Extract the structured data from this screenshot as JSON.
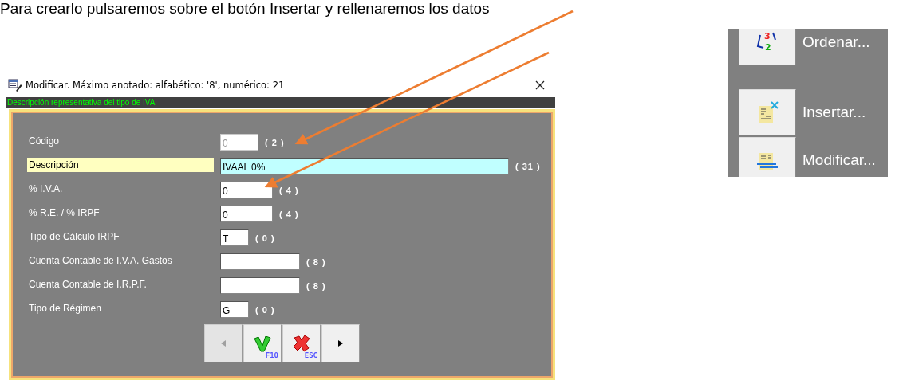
{
  "heading": "Para crearlo pulsaremos sobre el botón Insertar y rellenaremos los datos",
  "dialog": {
    "title": "Modificar.  Máximo anotado: alfabético: '8', numérico: 21",
    "hint": "Descripción representativa del tipo de IVA",
    "fields": [
      {
        "kind": "code",
        "label": "Código",
        "value": "0",
        "limit": "( 2 )",
        "focused": false,
        "disabled": true
      },
      {
        "kind": "text",
        "label": "Descripción",
        "value": "IVAAL 0%",
        "limit": "( 31 )",
        "focused": true,
        "disabled": false
      },
      {
        "kind": "number",
        "label": "% I.V.A.",
        "value": "0",
        "limit": "( 4 )",
        "focused": false,
        "disabled": false
      },
      {
        "kind": "number",
        "label": "% R.E. / % IRPF",
        "value": "0",
        "limit": "( 4 )",
        "focused": false,
        "disabled": false
      },
      {
        "kind": "flag",
        "label": "Tipo de Cálculo IRPF",
        "value": "T",
        "limit": "( 0 )",
        "focused": false,
        "disabled": false
      },
      {
        "kind": "account",
        "label": "Cuenta Contable de I.V.A. Gastos",
        "limit": "( 8 )",
        "focused": false
      },
      {
        "kind": "account",
        "label": "Cuenta Contable de I.R.P.F.",
        "limit": "( 8 )",
        "focused": false
      },
      {
        "kind": "flag",
        "label": "Tipo de Régimen",
        "value": "G",
        "limit": "( 0 )",
        "focused": false,
        "disabled": false
      }
    ],
    "buttons": [
      {
        "kind": "prev",
        "disabled": true
      },
      {
        "kind": "accept",
        "key": "F10",
        "disabled": false
      },
      {
        "kind": "cancel",
        "key": "ESC",
        "disabled": false
      },
      {
        "kind": "next",
        "disabled": false
      }
    ]
  },
  "side_menu": [
    {
      "kind": "sort",
      "icon_digits": [
        "3",
        "2"
      ],
      "label": "Ordenar..."
    },
    {
      "kind": "insert",
      "label": "Insertar..."
    },
    {
      "kind": "edit",
      "label": "Modificar..."
    }
  ]
}
